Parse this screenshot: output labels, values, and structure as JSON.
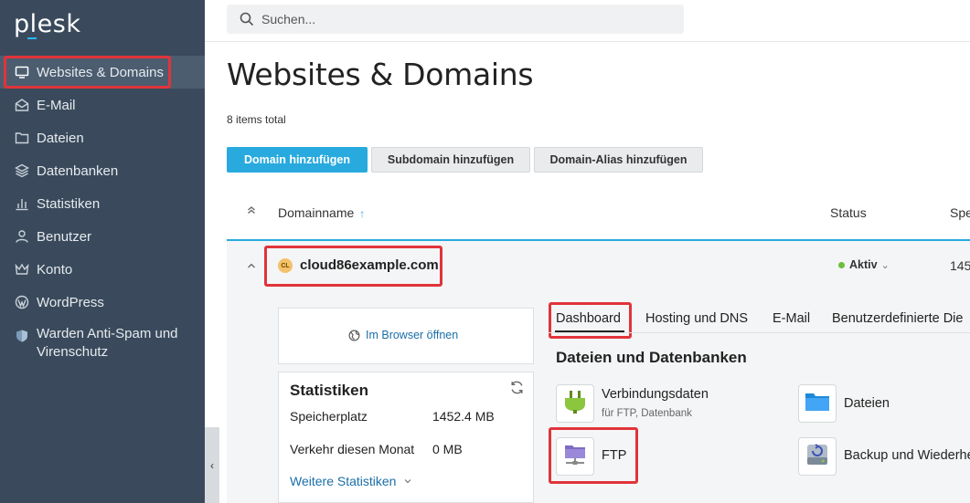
{
  "sidebar": {
    "logo": "plesk",
    "items": [
      {
        "label": "Websites & Domains"
      },
      {
        "label": "E-Mail"
      },
      {
        "label": "Dateien"
      },
      {
        "label": "Datenbanken"
      },
      {
        "label": "Statistiken"
      },
      {
        "label": "Benutzer"
      },
      {
        "label": "Konto"
      },
      {
        "label": "WordPress"
      },
      {
        "label": "Warden Anti-Spam und Virenschutz"
      }
    ],
    "collapse_glyph": "‹"
  },
  "search": {
    "placeholder": "Suchen..."
  },
  "main": {
    "title": "Websites & Domains",
    "items_total": "8 items total",
    "buttons": {
      "add_domain": "Domain hinzufügen",
      "add_subdomain": "Subdomain hinzufügen",
      "add_alias": "Domain-Alias hinzufügen"
    },
    "columns": {
      "domain": "Domainname",
      "sort_glyph": "↑",
      "status": "Status",
      "third": "Spe"
    },
    "domain": {
      "badge": "CL",
      "name": "cloud86example.com",
      "status": "Aktiv",
      "status_glyph": "⌄",
      "third_value": "145"
    },
    "browser_link": "Im Browser öffnen",
    "stats": {
      "title": "Statistiken",
      "rows": [
        {
          "label": "Speicherplatz",
          "value": "1452.4 MB"
        },
        {
          "label": "Verkehr diesen Monat",
          "value": "0 MB"
        }
      ],
      "more": "Weitere Statistiken"
    },
    "tabs": [
      {
        "label": "Dashboard"
      },
      {
        "label": "Hosting und DNS"
      },
      {
        "label": "E-Mail"
      },
      {
        "label": "Benutzerdefinierte Die"
      }
    ],
    "section_title": "Dateien und Datenbanken",
    "tools": {
      "connection": {
        "label": "Verbindungsdaten",
        "sub": "für FTP, Datenbank"
      },
      "files": {
        "label": "Dateien"
      },
      "ftp": {
        "label": "FTP"
      },
      "backup": {
        "label": "Backup und Wiederhe"
      }
    }
  }
}
